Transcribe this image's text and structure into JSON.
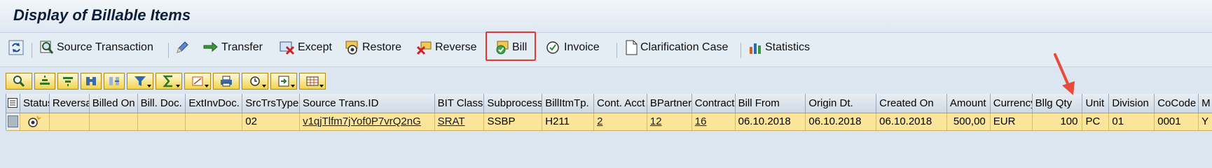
{
  "page": {
    "title": "Display of Billable Items"
  },
  "toolbar": {
    "source_transaction": "Source Transaction",
    "transfer": "Transfer",
    "except": "Except",
    "restore": "Restore",
    "reverse": "Reverse",
    "bill": "Bill",
    "invoice": "Invoice",
    "clarification_case": "Clarification Case",
    "statistics": "Statistics"
  },
  "table": {
    "columns": [
      "Status",
      "Reversal",
      "Billed On",
      "Bill. Doc.",
      "ExtInvDoc.",
      "SrcTrsType",
      "Source Trans.ID",
      "BIT Class",
      "Subprocess",
      "BillItmTp.",
      "Cont. Acct",
      "BPartner",
      "Contract",
      "Bill From",
      "Origin Dt.",
      "Created On",
      "Amount",
      "Currency",
      "Bllg Qty",
      "Unit",
      "Division",
      "CoCode",
      "M"
    ],
    "rows": [
      {
        "status": "",
        "reversal": "",
        "billed_on": "",
        "bill_doc": "",
        "ext_inv_doc": "",
        "src_trs_type": "02",
        "source_trans_id": "v1qjTlfm7jYof0P7vrQ2nG",
        "bit_class": "SRAT",
        "subprocess": "SSBP",
        "bill_itm_tp": "H211",
        "cont_acct": "2",
        "bpartner": "12",
        "contract": "16",
        "bill_from": "06.10.2018",
        "origin_dt": "06.10.2018",
        "created_on": "06.10.2018",
        "amount": "500,00",
        "currency": "EUR",
        "bllg_qty": "100",
        "unit": "PC",
        "division": "01",
        "cocode": "0001",
        "m": "Y"
      }
    ]
  },
  "colors": {
    "highlight_box": "#e03a36",
    "annotation_arrow": "#e84a3c",
    "selected_row": "#fbe59a"
  }
}
